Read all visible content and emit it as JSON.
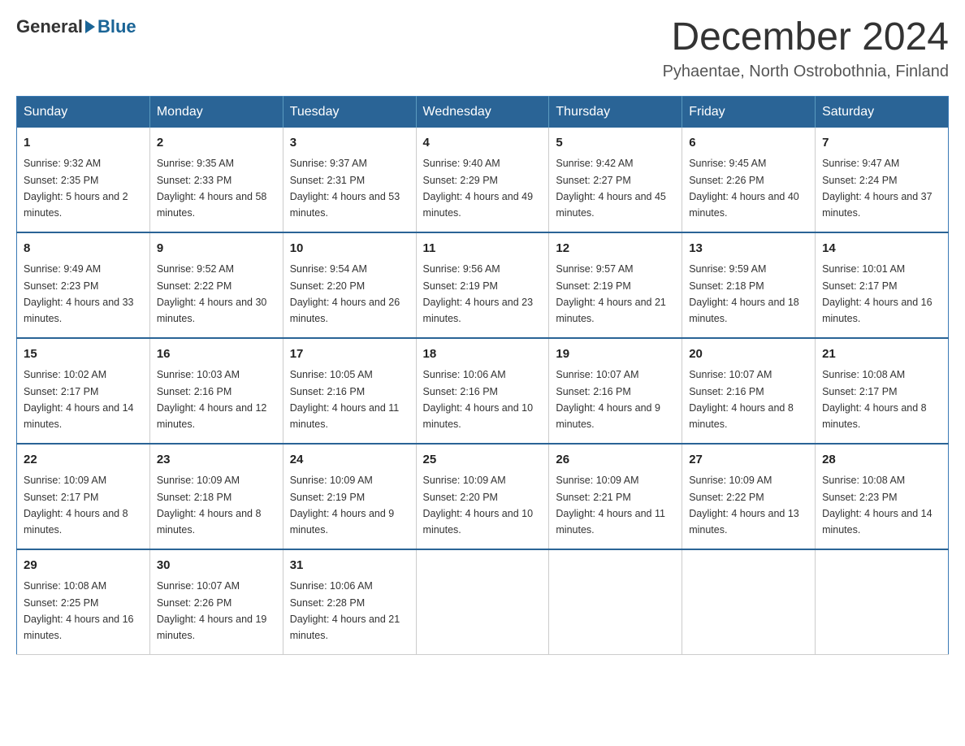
{
  "logo": {
    "general": "General",
    "blue": "Blue"
  },
  "title": "December 2024",
  "location": "Pyhaentae, North Ostrobothnia, Finland",
  "days_of_week": [
    "Sunday",
    "Monday",
    "Tuesday",
    "Wednesday",
    "Thursday",
    "Friday",
    "Saturday"
  ],
  "weeks": [
    [
      {
        "day": "1",
        "sunrise": "9:32 AM",
        "sunset": "2:35 PM",
        "daylight": "5 hours and 2 minutes."
      },
      {
        "day": "2",
        "sunrise": "9:35 AM",
        "sunset": "2:33 PM",
        "daylight": "4 hours and 58 minutes."
      },
      {
        "day": "3",
        "sunrise": "9:37 AM",
        "sunset": "2:31 PM",
        "daylight": "4 hours and 53 minutes."
      },
      {
        "day": "4",
        "sunrise": "9:40 AM",
        "sunset": "2:29 PM",
        "daylight": "4 hours and 49 minutes."
      },
      {
        "day": "5",
        "sunrise": "9:42 AM",
        "sunset": "2:27 PM",
        "daylight": "4 hours and 45 minutes."
      },
      {
        "day": "6",
        "sunrise": "9:45 AM",
        "sunset": "2:26 PM",
        "daylight": "4 hours and 40 minutes."
      },
      {
        "day": "7",
        "sunrise": "9:47 AM",
        "sunset": "2:24 PM",
        "daylight": "4 hours and 37 minutes."
      }
    ],
    [
      {
        "day": "8",
        "sunrise": "9:49 AM",
        "sunset": "2:23 PM",
        "daylight": "4 hours and 33 minutes."
      },
      {
        "day": "9",
        "sunrise": "9:52 AM",
        "sunset": "2:22 PM",
        "daylight": "4 hours and 30 minutes."
      },
      {
        "day": "10",
        "sunrise": "9:54 AM",
        "sunset": "2:20 PM",
        "daylight": "4 hours and 26 minutes."
      },
      {
        "day": "11",
        "sunrise": "9:56 AM",
        "sunset": "2:19 PM",
        "daylight": "4 hours and 23 minutes."
      },
      {
        "day": "12",
        "sunrise": "9:57 AM",
        "sunset": "2:19 PM",
        "daylight": "4 hours and 21 minutes."
      },
      {
        "day": "13",
        "sunrise": "9:59 AM",
        "sunset": "2:18 PM",
        "daylight": "4 hours and 18 minutes."
      },
      {
        "day": "14",
        "sunrise": "10:01 AM",
        "sunset": "2:17 PM",
        "daylight": "4 hours and 16 minutes."
      }
    ],
    [
      {
        "day": "15",
        "sunrise": "10:02 AM",
        "sunset": "2:17 PM",
        "daylight": "4 hours and 14 minutes."
      },
      {
        "day": "16",
        "sunrise": "10:03 AM",
        "sunset": "2:16 PM",
        "daylight": "4 hours and 12 minutes."
      },
      {
        "day": "17",
        "sunrise": "10:05 AM",
        "sunset": "2:16 PM",
        "daylight": "4 hours and 11 minutes."
      },
      {
        "day": "18",
        "sunrise": "10:06 AM",
        "sunset": "2:16 PM",
        "daylight": "4 hours and 10 minutes."
      },
      {
        "day": "19",
        "sunrise": "10:07 AM",
        "sunset": "2:16 PM",
        "daylight": "4 hours and 9 minutes."
      },
      {
        "day": "20",
        "sunrise": "10:07 AM",
        "sunset": "2:16 PM",
        "daylight": "4 hours and 8 minutes."
      },
      {
        "day": "21",
        "sunrise": "10:08 AM",
        "sunset": "2:17 PM",
        "daylight": "4 hours and 8 minutes."
      }
    ],
    [
      {
        "day": "22",
        "sunrise": "10:09 AM",
        "sunset": "2:17 PM",
        "daylight": "4 hours and 8 minutes."
      },
      {
        "day": "23",
        "sunrise": "10:09 AM",
        "sunset": "2:18 PM",
        "daylight": "4 hours and 8 minutes."
      },
      {
        "day": "24",
        "sunrise": "10:09 AM",
        "sunset": "2:19 PM",
        "daylight": "4 hours and 9 minutes."
      },
      {
        "day": "25",
        "sunrise": "10:09 AM",
        "sunset": "2:20 PM",
        "daylight": "4 hours and 10 minutes."
      },
      {
        "day": "26",
        "sunrise": "10:09 AM",
        "sunset": "2:21 PM",
        "daylight": "4 hours and 11 minutes."
      },
      {
        "day": "27",
        "sunrise": "10:09 AM",
        "sunset": "2:22 PM",
        "daylight": "4 hours and 13 minutes."
      },
      {
        "day": "28",
        "sunrise": "10:08 AM",
        "sunset": "2:23 PM",
        "daylight": "4 hours and 14 minutes."
      }
    ],
    [
      {
        "day": "29",
        "sunrise": "10:08 AM",
        "sunset": "2:25 PM",
        "daylight": "4 hours and 16 minutes."
      },
      {
        "day": "30",
        "sunrise": "10:07 AM",
        "sunset": "2:26 PM",
        "daylight": "4 hours and 19 minutes."
      },
      {
        "day": "31",
        "sunrise": "10:06 AM",
        "sunset": "2:28 PM",
        "daylight": "4 hours and 21 minutes."
      },
      null,
      null,
      null,
      null
    ]
  ]
}
